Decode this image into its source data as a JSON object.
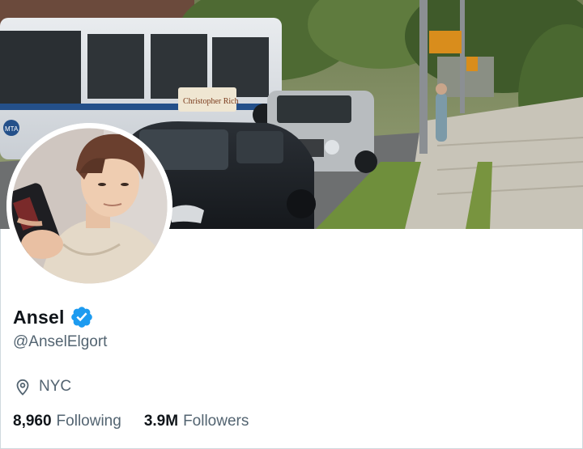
{
  "profile": {
    "display_name": "Ansel",
    "handle": "@AnselElgort",
    "location": "NYC",
    "stats": {
      "following_count": "8,960",
      "following_label": "Following",
      "followers_count": "3.9M",
      "followers_label": "Followers"
    }
  },
  "banner": {
    "bus_side_text": "Christopher Rich",
    "bus_route_text": "MTA"
  },
  "icons": {
    "verified": "verified-badge-icon",
    "location": "location-pin-icon"
  },
  "colors": {
    "verified_blue": "#1d9bf0",
    "secondary_text": "#536471",
    "primary_text": "#0f1419"
  }
}
